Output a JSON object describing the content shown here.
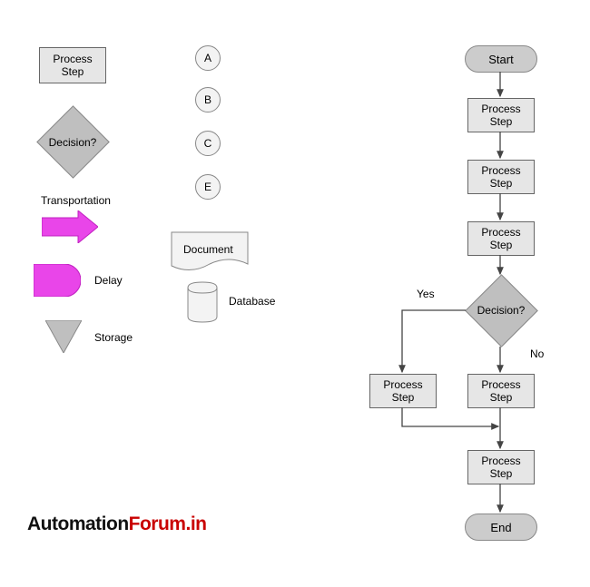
{
  "legend": {
    "process_step": "Process\nStep",
    "decision": "Decision?",
    "transportation": "Transportation",
    "delay": "Delay",
    "storage": "Storage",
    "circles": [
      "A",
      "B",
      "C",
      "E"
    ],
    "document": "Document",
    "database": "Database"
  },
  "flow": {
    "start": "Start",
    "step1": "Process\nStep",
    "step2": "Process\nStep",
    "step3": "Process\nStep",
    "decision": "Decision?",
    "yes": "Yes",
    "no": "No",
    "step_yes": "Process\nStep",
    "step_no": "Process\nStep",
    "step_merge": "Process\nStep",
    "end": "End"
  },
  "watermark": {
    "part1": "Automation",
    "part2": "Forum.in"
  }
}
